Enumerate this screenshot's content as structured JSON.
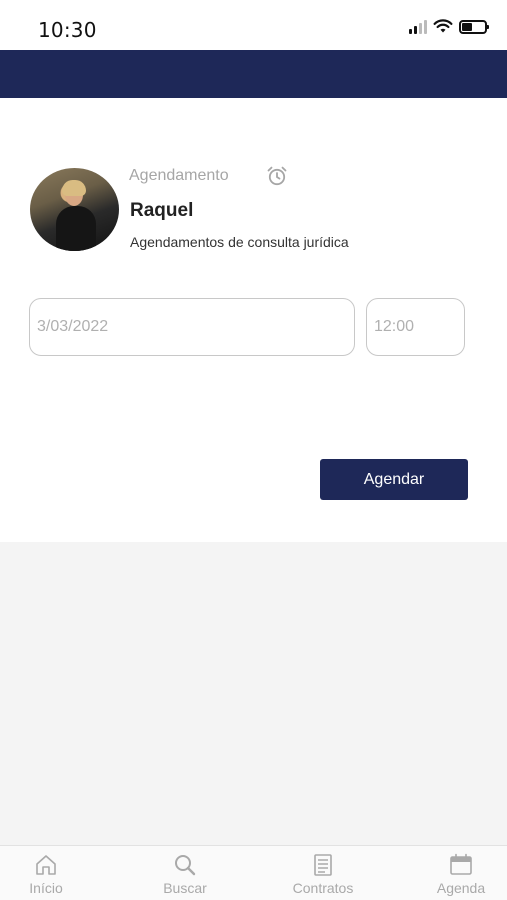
{
  "status_bar": {
    "time": "10:30"
  },
  "appointment": {
    "section_label": "Agendamento",
    "name": "Raquel",
    "description": "Agendamentos de consulta jurídica"
  },
  "form": {
    "date_placeholder": "3/03/2022",
    "time_placeholder": "12:00",
    "submit_label": "Agendar"
  },
  "tabbar": {
    "items": [
      {
        "label": "Início",
        "icon": "home-icon"
      },
      {
        "label": "Buscar",
        "icon": "search-icon"
      },
      {
        "label": "Contratos",
        "icon": "document-icon"
      },
      {
        "label": "Agenda",
        "icon": "calendar-icon"
      }
    ]
  },
  "colors": {
    "primary": "#1e2858",
    "muted": "#a9a9a9"
  }
}
